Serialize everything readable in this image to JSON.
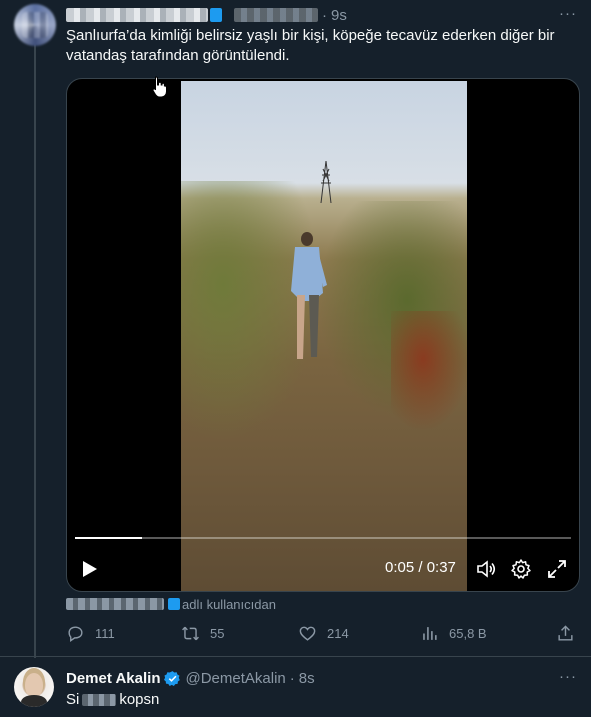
{
  "tweet": {
    "time": "9s",
    "dot": "·",
    "more": "···",
    "text": "Şanlıurfa’da kimliği belirsiz yaşlı bir kişi, köpeğe tecavüz ederken diğer bir vatandaş tarafından görüntülendi.",
    "video": {
      "progress": 0.135,
      "timecode": "0:05 / 0:37"
    },
    "attribution_suffix": "adlı kullanıcıdan",
    "actions": {
      "replies": "111",
      "retweets": "55",
      "likes": "214",
      "views": "65,8 B"
    }
  },
  "reply": {
    "name": "Demet Akalin",
    "handle": "@DemetAkalin",
    "dot": "·",
    "time": "8s",
    "more": "···",
    "text_start": "Si",
    "text_end": "kopsn"
  },
  "colors": {
    "background": "#15202b",
    "muted": "#8b98a5",
    "accent": "#1d9bf0",
    "border": "#38444d"
  },
  "icons": [
    "reply-icon",
    "retweet-icon",
    "like-icon",
    "views-icon",
    "share-icon",
    "play-icon",
    "volume-icon",
    "settings-icon",
    "fullscreen-icon",
    "verified-icon",
    "cursor-icon"
  ]
}
